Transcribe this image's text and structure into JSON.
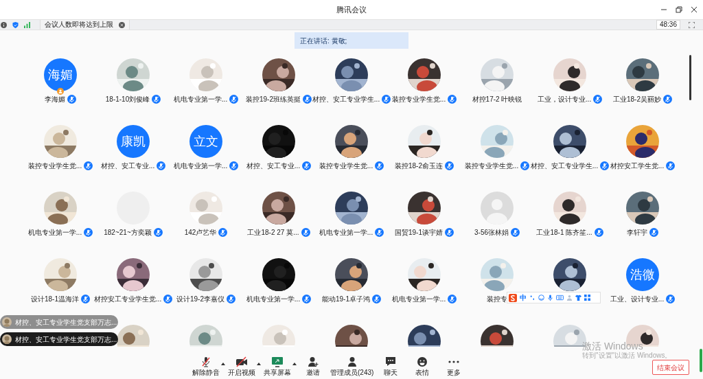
{
  "window": {
    "title": "腾讯会议"
  },
  "info_bar": {
    "notice": "会议人数即将达到上限",
    "timer": "48:36"
  },
  "speaker_banner": "正在讲话: 黄敬;",
  "participants": [
    [
      {
        "avatar": {
          "kind": "text",
          "text": "海媚"
        },
        "host": true,
        "name": "李海媚",
        "muted": true
      },
      {
        "avatar": {
          "kind": "picture"
        },
        "host": false,
        "name": "18-1-10刘俊峰",
        "muted": true
      },
      {
        "avatar": {
          "kind": "picture"
        },
        "host": false,
        "name": "机电专业第一学...",
        "muted": true
      },
      {
        "avatar": {
          "kind": "picture"
        },
        "host": false,
        "name": "装控19-2班练英挺",
        "muted": true
      },
      {
        "avatar": {
          "kind": "picture"
        },
        "host": false,
        "name": "材控、安工专业学生...",
        "muted": true
      },
      {
        "avatar": {
          "kind": "picture"
        },
        "host": false,
        "name": "装控专业学生党...",
        "muted": true
      },
      {
        "avatar": {
          "kind": "picture"
        },
        "host": false,
        "name": "材控17-2 叶映锐",
        "muted": false
      },
      {
        "avatar": {
          "kind": "picture"
        },
        "host": false,
        "name": "工业，设计专业...",
        "muted": true
      },
      {
        "avatar": {
          "kind": "picture"
        },
        "host": false,
        "name": "工业18-2吴丽妙",
        "muted": true
      }
    ],
    [
      {
        "avatar": {
          "kind": "picture"
        },
        "host": false,
        "name": "装控专业学生党...",
        "muted": true
      },
      {
        "avatar": {
          "kind": "text",
          "text": "康凯"
        },
        "host": false,
        "name": "材控、安工专业...",
        "muted": true
      },
      {
        "avatar": {
          "kind": "text",
          "text": "立文"
        },
        "host": false,
        "name": "机电专业第一学...",
        "muted": true
      },
      {
        "avatar": {
          "kind": "picture"
        },
        "host": false,
        "name": "材控、安工专业...",
        "muted": true
      },
      {
        "avatar": {
          "kind": "picture"
        },
        "host": false,
        "name": "装控专业学生党...",
        "muted": true
      },
      {
        "avatar": {
          "kind": "picture"
        },
        "host": false,
        "name": "装控18-2俞玉连",
        "muted": true
      },
      {
        "avatar": {
          "kind": "picture"
        },
        "host": false,
        "name": "装控专业学生党...",
        "muted": true
      },
      {
        "avatar": {
          "kind": "picture"
        },
        "host": false,
        "name": "材控、安工专业学生...",
        "muted": true
      },
      {
        "avatar": {
          "kind": "picture"
        },
        "host": false,
        "name": "材控安工学生党...",
        "muted": true
      }
    ],
    [
      {
        "avatar": {
          "kind": "picture"
        },
        "host": false,
        "name": "机电专业第一学...",
        "muted": true
      },
      {
        "avatar": {
          "kind": "blank"
        },
        "host": false,
        "name": "182~21~方奕颖",
        "muted": true
      },
      {
        "avatar": {
          "kind": "picture"
        },
        "host": false,
        "name": "142卢艺华",
        "muted": true
      },
      {
        "avatar": {
          "kind": "picture"
        },
        "host": false,
        "name": "工业18-2 27 莫...",
        "muted": true
      },
      {
        "avatar": {
          "kind": "picture"
        },
        "host": false,
        "name": "机电专业第一学...",
        "muted": true
      },
      {
        "avatar": {
          "kind": "picture"
        },
        "host": false,
        "name": "国贸19-1谈宇婧",
        "muted": true
      },
      {
        "avatar": {
          "kind": "default"
        },
        "host": false,
        "name": "3-56张林娟",
        "muted": true
      },
      {
        "avatar": {
          "kind": "picture"
        },
        "host": false,
        "name": "工业18-1 陈齐笙...",
        "muted": true
      },
      {
        "avatar": {
          "kind": "picture"
        },
        "host": false,
        "name": "李轩宇",
        "muted": true
      }
    ],
    [
      {
        "avatar": {
          "kind": "picture"
        },
        "host": false,
        "name": "设计18-1温海洋",
        "muted": true
      },
      {
        "avatar": {
          "kind": "picture"
        },
        "host": false,
        "name": "材控安工专业学生党...",
        "muted": true
      },
      {
        "avatar": {
          "kind": "picture"
        },
        "host": false,
        "name": "设计19-2李嘉仪",
        "muted": true
      },
      {
        "avatar": {
          "kind": "picture"
        },
        "host": false,
        "name": "机电专业第一学...",
        "muted": true
      },
      {
        "avatar": {
          "kind": "picture"
        },
        "host": false,
        "name": "能动19-1卓子鸿",
        "muted": true
      },
      {
        "avatar": {
          "kind": "picture"
        },
        "host": false,
        "name": "机电专业第一学...",
        "muted": true
      },
      {
        "avatar": {
          "kind": "picture"
        },
        "name": "装控专"
      },
      {
        "avatar": {
          "kind": "picture"
        }
      },
      {
        "avatar": {
          "kind": "text",
          "text": "浩微"
        },
        "host": false,
        "name": "工业、设计专业...",
        "muted": true
      }
    ],
    [
      {
        "avatar": {
          "kind": "picture"
        }
      },
      {
        "avatar": {
          "kind": "picture"
        }
      },
      {
        "avatar": {
          "kind": "picture"
        }
      },
      {
        "avatar": {
          "kind": "picture"
        }
      },
      {
        "avatar": {
          "kind": "picture"
        }
      },
      {
        "avatar": {
          "kind": "picture"
        }
      },
      {
        "avatar": {
          "kind": "picture"
        }
      },
      {
        "avatar": {
          "kind": "picture"
        }
      }
    ]
  ],
  "chat_bubbles": [
    {
      "text": "材控、安工专业学生党支部万志..."
    },
    {
      "text": "材控、安工专业学生党支部万志..."
    }
  ],
  "ime_toolbar": {
    "mode": "中"
  },
  "toolbar": [
    {
      "kind": "mic",
      "label": "解除静音",
      "menu": true
    },
    {
      "kind": "video",
      "label": "开启视频",
      "menu": true
    },
    {
      "kind": "share",
      "label": "共享屏幕",
      "menu": true
    },
    {
      "kind": "invite",
      "label": "邀请",
      "menu": false
    },
    {
      "kind": "members",
      "label": "管理成员(243)",
      "menu": false
    },
    {
      "kind": "chat",
      "label": "聊天",
      "menu": false
    },
    {
      "kind": "emoji",
      "label": "表情",
      "menu": false
    },
    {
      "kind": "more",
      "label": "更多",
      "menu": false
    }
  ],
  "end_button": "结束会议",
  "os_watermark": {
    "title": "激活 Windows",
    "subtitle": "转到\"设置\"以激活 Windows。"
  }
}
